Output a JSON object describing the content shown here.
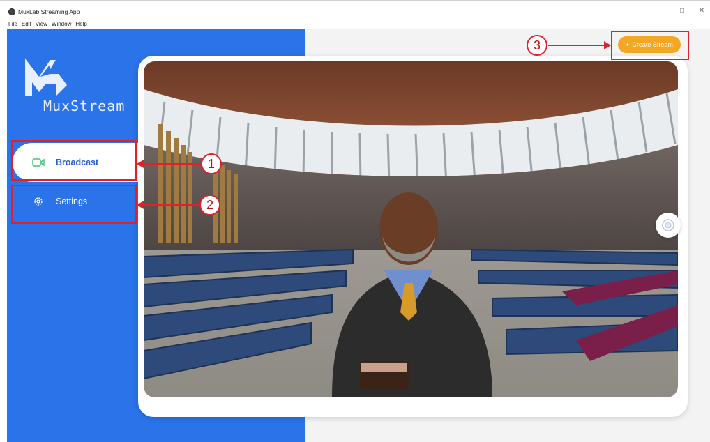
{
  "window": {
    "title": "MuxLab Streaming App",
    "controls": {
      "minimize": "−",
      "maximize": "□",
      "close": "✕"
    }
  },
  "menu": [
    "File",
    "Edit",
    "View",
    "Window",
    "Help"
  ],
  "brand": {
    "name": "MuxStream",
    "icon": "muxstream-logo"
  },
  "nav": {
    "items": [
      {
        "label": "Broadcast",
        "icon": "camera-icon",
        "active": true
      },
      {
        "label": "Settings",
        "icon": "gear-icon",
        "active": false
      }
    ]
  },
  "toolbar": {
    "create_label": "Create Stream",
    "create_icon": "plus-icon"
  },
  "annotations": [
    "1",
    "2",
    "3"
  ],
  "colors": {
    "sidebar": "#2a73e8",
    "accent": "#f5a623",
    "annotation": "#e0202a",
    "active_text": "#2a5fd0"
  },
  "preview": {
    "icon": "church-background-with-presenter"
  },
  "controls": {
    "joystick_icon": "joystick-icon"
  }
}
